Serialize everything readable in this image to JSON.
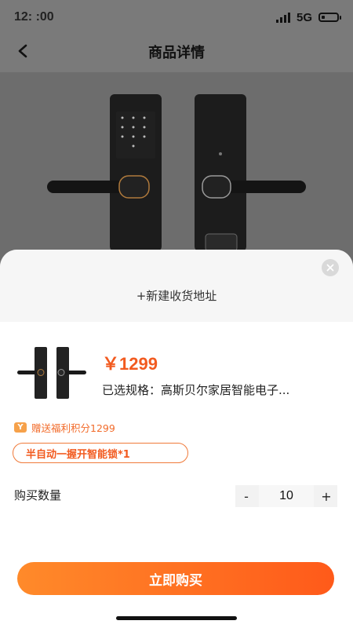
{
  "status": {
    "time": "12:  :00",
    "network": "5G"
  },
  "nav": {
    "title": "商品详情"
  },
  "sheet": {
    "address_label": "+新建收货地址",
    "price": "￥1299",
    "spec": "已选规格：高斯贝尔家居智能电子...",
    "points_icon": "Y",
    "points": "赠送福利积分1299",
    "gift": "半自动一握开智能锁*1",
    "quantity_label": "购买数量",
    "quantity": "10",
    "minus": "-",
    "plus": "+",
    "buy_label": "立即购买"
  },
  "colors": {
    "accent": "#f25a1f",
    "button_start": "#ff8a2a",
    "button_end": "#ff5a1a"
  }
}
